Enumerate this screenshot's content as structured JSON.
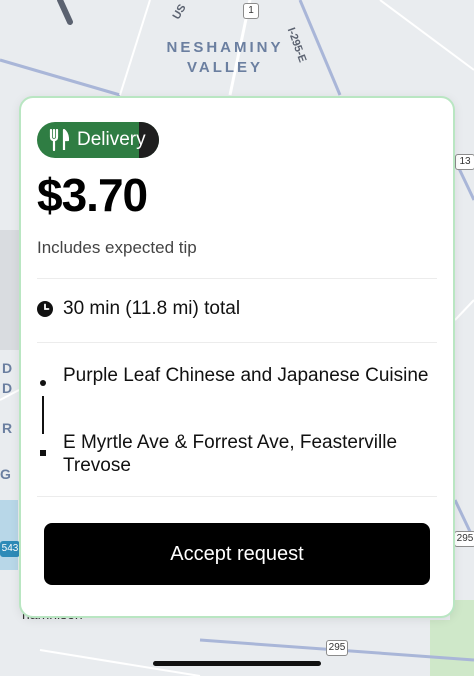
{
  "map": {
    "area_label_line1": "NESHAMINY",
    "area_label_line2": "VALLEY",
    "road_i295": "I-295-E",
    "road_us": "US",
    "shield_1": "1",
    "shield_13": "13",
    "shield_295_right": "295",
    "shield_295_bottom": "295",
    "shield_543": "543",
    "edge_letters": [
      "D",
      "D",
      "R",
      "G"
    ],
    "bottom_text": "namnison"
  },
  "offer": {
    "badge_label": "Delivery",
    "price": "$3.70",
    "price_note": "Includes expected tip",
    "duration": "30 min (11.8 mi) total",
    "pickup": "Purple Leaf Chinese and Japanese Cuisine",
    "dropoff": "E Myrtle Ave & Forrest Ave, Feasterville Trevose",
    "accept_label": "Accept request"
  },
  "colors": {
    "badge_green": "#2f7d43",
    "card_border": "#b9e6c2",
    "button_black": "#000000"
  },
  "icons": {
    "badge": "fork-knife-icon",
    "duration": "clock-icon"
  }
}
